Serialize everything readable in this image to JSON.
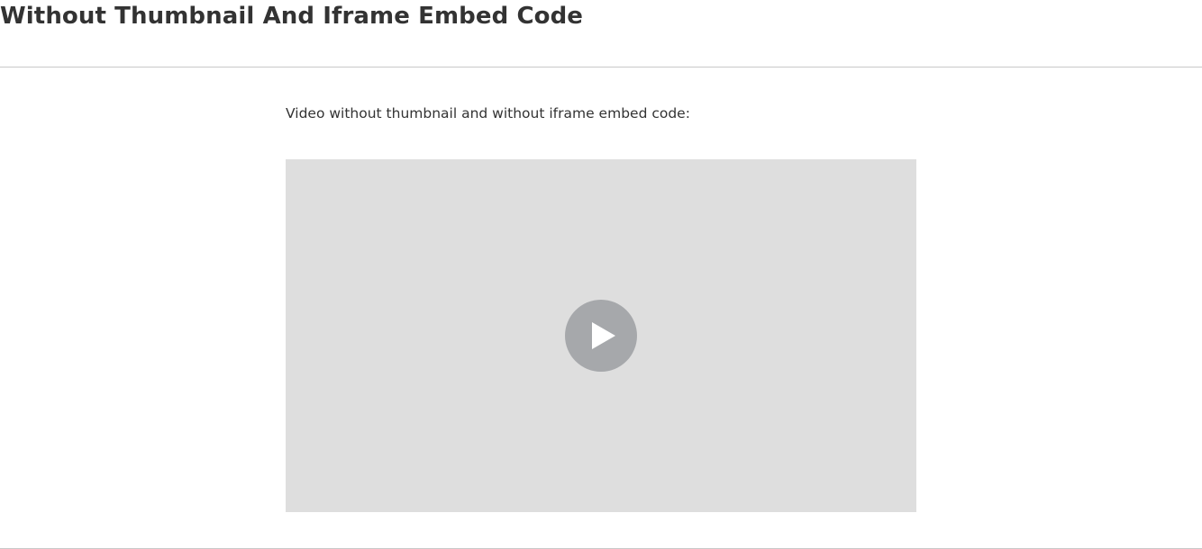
{
  "header": {
    "title": "Without Thumbnail And Iframe Embed Code"
  },
  "content": {
    "description": "Video without thumbnail and without iframe embed code:"
  },
  "video": {
    "play_icon": "play-icon",
    "background_color": "#dedede",
    "button_color": "#a6a8ab"
  }
}
